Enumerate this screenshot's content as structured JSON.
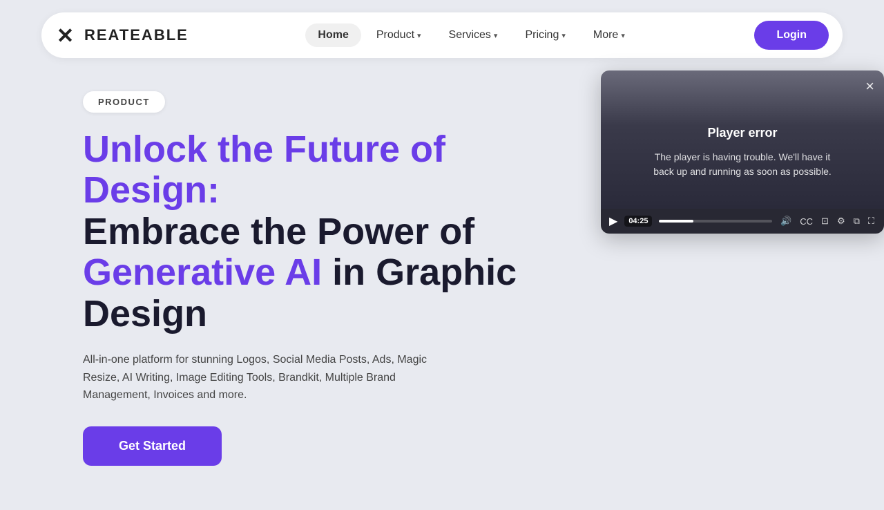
{
  "navbar": {
    "logo_text": "REATEABLE",
    "nav_items": [
      {
        "label": "Home",
        "active": true,
        "has_dropdown": false
      },
      {
        "label": "Product",
        "active": false,
        "has_dropdown": true
      },
      {
        "label": "Services",
        "active": false,
        "has_dropdown": true
      },
      {
        "label": "Pricing",
        "active": false,
        "has_dropdown": true
      },
      {
        "label": "More",
        "active": false,
        "has_dropdown": true
      }
    ],
    "login_label": "Login"
  },
  "hero": {
    "badge": "PRODUCT",
    "heading_line1": "Unlock the Future of",
    "heading_line2": "Design:",
    "heading_line3": "Embrace the Power of",
    "heading_highlight": "Generative AI",
    "heading_line4": "in Graphic Design",
    "description": "All-in-one platform for stunning Logos, Social Media Posts, Ads, Magic Resize, AI Writing, Image Editing Tools, Brandkit, Multiple Brand Management, Invoices and more.",
    "cta_label": "Get Started"
  },
  "video_player": {
    "error_title": "Player error",
    "error_message": "The player is having trouble. We'll have it back up and running as soon as possible.",
    "close_label": "×",
    "timestamp": "04:25",
    "progress_percent": 30
  },
  "colors": {
    "accent": "#6a3de8",
    "dark_text": "#1a1a2e",
    "body_text": "#444444",
    "bg": "#e8eaf0"
  }
}
